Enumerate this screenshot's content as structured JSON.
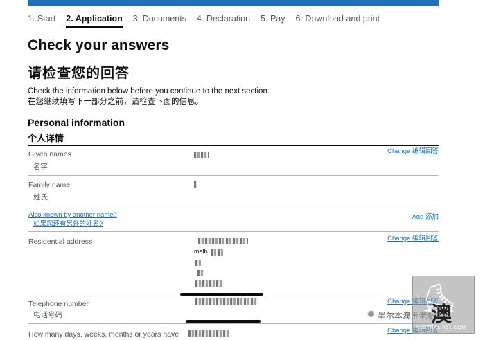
{
  "steps": [
    "1. Start",
    "2. Application",
    "3. Documents",
    "4. Declaration",
    "5. Pay",
    "6. Download and print"
  ],
  "title": "Check your answers",
  "title_cn": "请检查您的回答",
  "intro": "Check the information below before you continue to the next section.",
  "intro_cn": "在您继续填写下一部分之前，请检查下面的信息。",
  "section": "Personal information",
  "section_cn": "个人详情",
  "rows": {
    "given": {
      "label": "Given names",
      "label_cn": "名字",
      "change": "Change 编辑回答"
    },
    "family": {
      "label": "Family name",
      "label_cn": "姓氏"
    },
    "aka": {
      "label": "Also known by another name?",
      "label_cn": "如果您还有另外的姓名?",
      "add": "Add 添加"
    },
    "address": {
      "label": "Residential address",
      "change": "Change 编辑回答",
      "line2": "melb"
    },
    "phone": {
      "label": "Telephone number",
      "label_cn": "电话号码",
      "change": "Change 编辑回答"
    },
    "days": {
      "label": "How many days, weeks, months or years have",
      "change": "Change 编辑回答"
    }
  },
  "watermark": {
    "text": "墨尔本澳洲老帆",
    "domain": "AUSTRALIA51.COM",
    "char": "澳",
    "icon": "kangaroo-icon"
  }
}
